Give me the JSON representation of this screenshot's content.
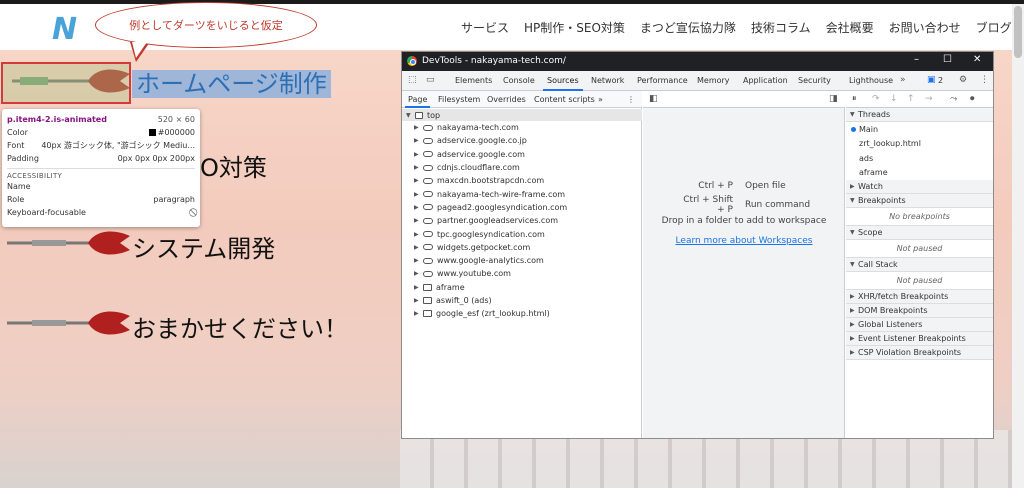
{
  "site": {
    "logo_text": "N",
    "nav": [
      "サービス",
      "HP制作・SEO対策",
      "まつど宣伝協力隊",
      "技術コラム",
      "会社概要",
      "お問い合わせ",
      "ブログ"
    ],
    "callout": "例としてダーツをいじると仮定",
    "hero_lines": [
      "ホームページ制作",
      "O対策",
      "システム開発",
      "おまかせください！"
    ]
  },
  "tooltip": {
    "selector": "p.item4-2.is-animated",
    "size": "520 × 60",
    "color_label": "Color",
    "color_value": "#000000",
    "font_label": "Font",
    "font_value": "40px 游ゴシック体, \"游ゴシック Mediu...",
    "padding_label": "Padding",
    "padding_value": "0px 0px 0px 200px",
    "accessibility": "ACCESSIBILITY",
    "name_label": "Name",
    "name_value": "",
    "role_label": "Role",
    "role_value": "paragraph",
    "kbd_label": "Keyboard-focusable"
  },
  "devtools": {
    "title": "DevTools - nakayama-tech.com/",
    "tabs": [
      "Elements",
      "Console",
      "Sources",
      "Network",
      "Performance",
      "Memory",
      "Application",
      "Security",
      "Lighthouse"
    ],
    "active_tab": "Sources",
    "badge": "2",
    "subtabs": [
      "Page",
      "Filesystem",
      "Overrides",
      "Content scripts"
    ],
    "tree_root": "top",
    "tree_items": [
      {
        "label": "nakayama-tech.com",
        "icon": "cloud"
      },
      {
        "label": "adservice.google.co.jp",
        "icon": "cloud"
      },
      {
        "label": "adservice.google.com",
        "icon": "cloud"
      },
      {
        "label": "cdnjs.cloudflare.com",
        "icon": "cloud"
      },
      {
        "label": "maxcdn.bootstrapcdn.com",
        "icon": "cloud"
      },
      {
        "label": "nakayama-tech-wire-frame.com",
        "icon": "cloud"
      },
      {
        "label": "pagead2.googlesyndication.com",
        "icon": "cloud"
      },
      {
        "label": "partner.googleadservices.com",
        "icon": "cloud"
      },
      {
        "label": "tpc.googlesyndication.com",
        "icon": "cloud"
      },
      {
        "label": "widgets.getpocket.com",
        "icon": "cloud"
      },
      {
        "label": "www.google-analytics.com",
        "icon": "cloud"
      },
      {
        "label": "www.youtube.com",
        "icon": "cloud"
      },
      {
        "label": "aframe",
        "icon": "folder"
      },
      {
        "label": "aswift_0 (ads)",
        "icon": "folder"
      },
      {
        "label": "google_esf (zrt_lookup.html)",
        "icon": "folder"
      }
    ],
    "shortcuts": [
      {
        "keys": "Ctrl + P",
        "action": "Open file"
      },
      {
        "keys": "Ctrl + Shift + P",
        "action": "Run command"
      }
    ],
    "drop_text": "Drop in a folder to add to workspace",
    "learn_link": "Learn more about Workspaces",
    "threads_label": "Threads",
    "threads": [
      "Main",
      "zrt_lookup.html",
      "ads",
      "aframe"
    ],
    "watch_label": "Watch",
    "breakpoints_label": "Breakpoints",
    "no_breakpoints": "No breakpoints",
    "scope_label": "Scope",
    "not_paused": "Not paused",
    "callstack_label": "Call Stack",
    "other_sections": [
      "XHR/fetch Breakpoints",
      "DOM Breakpoints",
      "Global Listeners",
      "Event Listener Breakpoints",
      "CSP Violation Breakpoints"
    ]
  }
}
